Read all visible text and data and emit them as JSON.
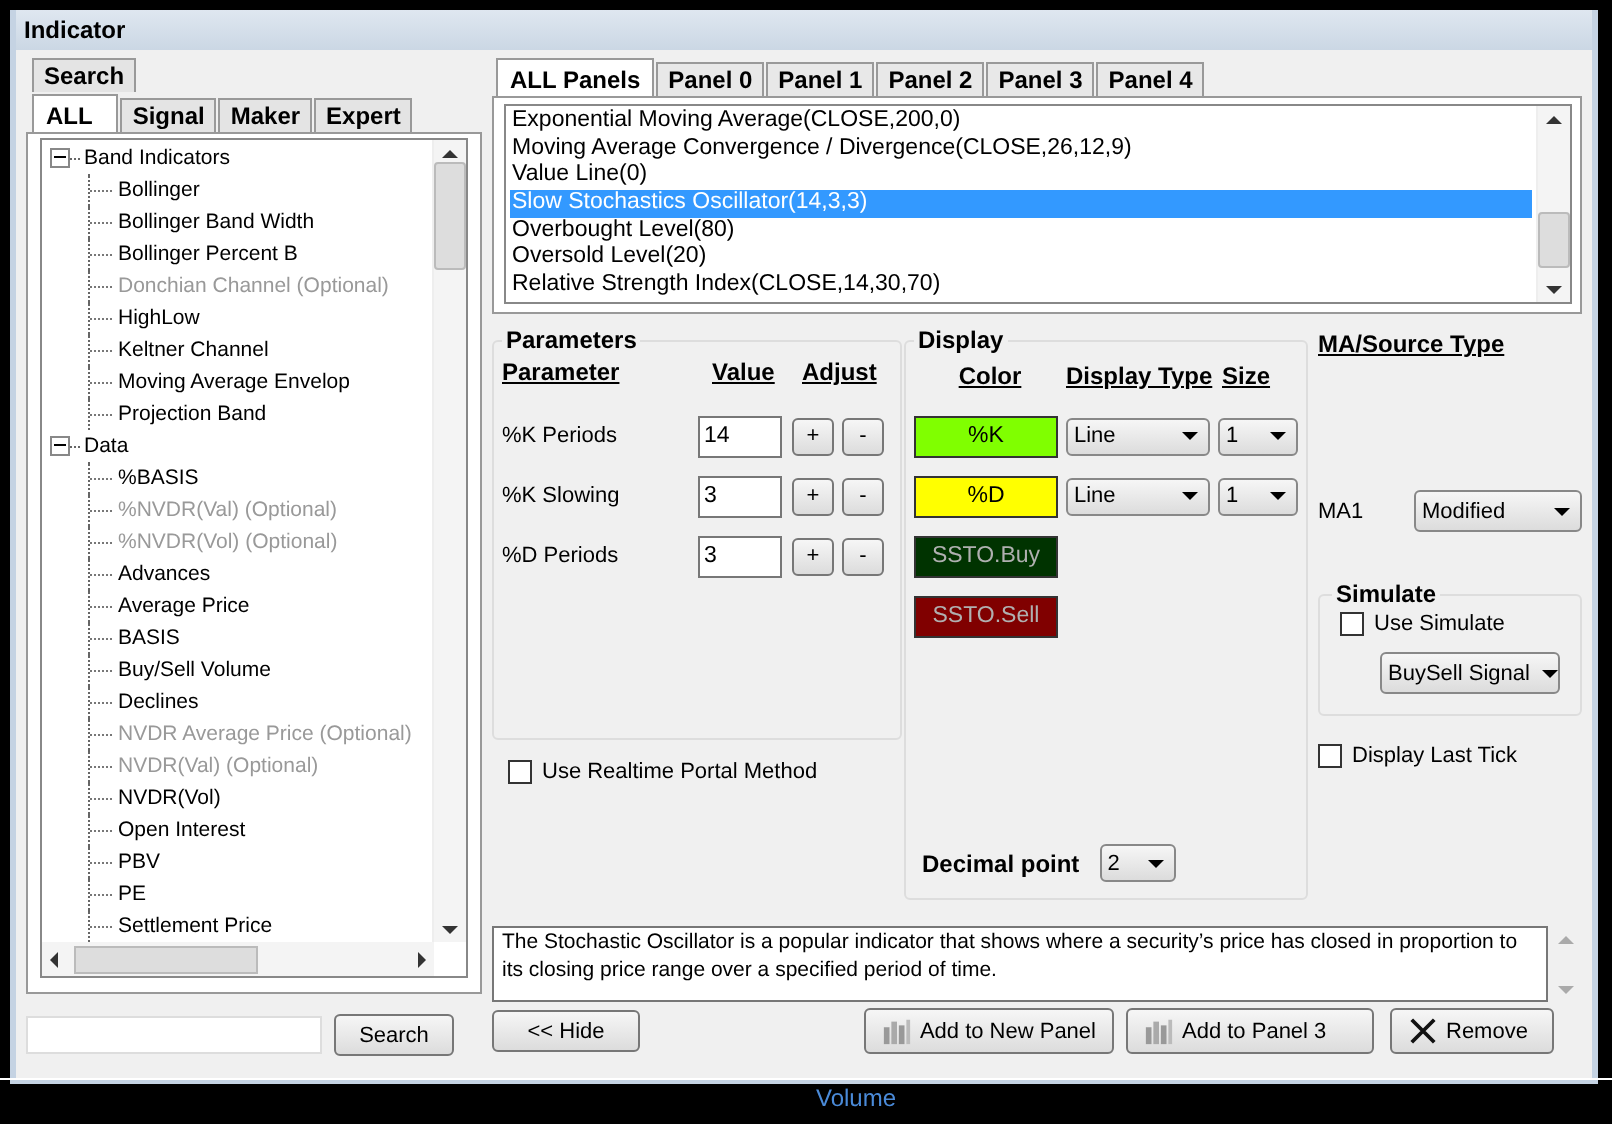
{
  "window": {
    "title": "Indicator"
  },
  "left_tab_rows": [
    [
      {
        "label": "Search",
        "selected": false
      }
    ],
    [
      {
        "label": "ALL",
        "selected": true
      },
      {
        "label": "Signal",
        "selected": false
      },
      {
        "label": "Maker",
        "selected": false
      },
      {
        "label": "Expert",
        "selected": false
      }
    ]
  ],
  "tree": [
    {
      "label": "Band Indicators",
      "expanded": true,
      "children": [
        {
          "label": "Bollinger",
          "disabled": false
        },
        {
          "label": "Bollinger Band Width",
          "disabled": false
        },
        {
          "label": "Bollinger Percent B",
          "disabled": false
        },
        {
          "label": "Donchian Channel (Optional)",
          "disabled": true
        },
        {
          "label": "HighLow",
          "disabled": false
        },
        {
          "label": "Keltner Channel",
          "disabled": false
        },
        {
          "label": "Moving Average Envelop",
          "disabled": false
        },
        {
          "label": "Projection Band",
          "disabled": false
        }
      ]
    },
    {
      "label": "Data",
      "expanded": true,
      "children": [
        {
          "label": "%BASIS",
          "disabled": false
        },
        {
          "label": "%NVDR(Val) (Optional)",
          "disabled": true
        },
        {
          "label": "%NVDR(Vol) (Optional)",
          "disabled": true
        },
        {
          "label": "Advances",
          "disabled": false
        },
        {
          "label": "Average Price",
          "disabled": false
        },
        {
          "label": "BASIS",
          "disabled": false
        },
        {
          "label": "Buy/Sell Volume",
          "disabled": false
        },
        {
          "label": "Declines",
          "disabled": false
        },
        {
          "label": "NVDR Average Price (Optional)",
          "disabled": true
        },
        {
          "label": "NVDR(Val) (Optional)",
          "disabled": true
        },
        {
          "label": "NVDR(Vol)",
          "disabled": false
        },
        {
          "label": "Open Interest",
          "disabled": false
        },
        {
          "label": "PBV",
          "disabled": false
        },
        {
          "label": "PE",
          "disabled": false
        },
        {
          "label": "Settlement Price",
          "disabled": false
        }
      ]
    }
  ],
  "search": {
    "button": "Search"
  },
  "panel_tabs": [
    {
      "label": "ALL Panels",
      "selected": true
    },
    {
      "label": "Panel 0",
      "selected": false
    },
    {
      "label": "Panel 1",
      "selected": false
    },
    {
      "label": "Panel 2",
      "selected": false
    },
    {
      "label": "Panel 3",
      "selected": false
    },
    {
      "label": "Panel 4",
      "selected": false
    }
  ],
  "indicators": [
    {
      "label": "Exponential Moving Average(CLOSE,200,0)",
      "selected": false
    },
    {
      "label": "Moving Average Convergence / Divergence(CLOSE,26,12,9)",
      "selected": false
    },
    {
      "label": "Value Line(0)",
      "selected": false
    },
    {
      "label": "Slow Stochastics Oscillator(14,3,3)",
      "selected": true
    },
    {
      "label": "Overbought Level(80)",
      "selected": false
    },
    {
      "label": "Oversold Level(20)",
      "selected": false
    },
    {
      "label": "Relative Strength Index(CLOSE,14,30,70)",
      "selected": false
    }
  ],
  "parameters": {
    "title": "Parameters",
    "headers": [
      "Parameter",
      "Value",
      "Adjust"
    ],
    "rows": [
      {
        "name": "%K Periods",
        "value": "14",
        "plus": "+",
        "minus": "-"
      },
      {
        "name": "%K Slowing",
        "value": "3",
        "plus": "+",
        "minus": "-"
      },
      {
        "name": "%D Periods",
        "value": "3",
        "plus": "+",
        "minus": "-"
      }
    ]
  },
  "realtime": {
    "label": "Use Realtime Portal Method",
    "checked": false
  },
  "display": {
    "title": "Display",
    "headers": [
      "Color",
      "Display Type",
      "Size"
    ],
    "rows": [
      {
        "kind": "line",
        "label": "%K",
        "color": "#80ff00",
        "type": "Line",
        "size": "1"
      },
      {
        "kind": "line",
        "label": "%D",
        "color": "#ffff00",
        "type": "Line",
        "size": "1"
      },
      {
        "kind": "signal",
        "label": "SSTO.Buy",
        "color": "#003300"
      },
      {
        "kind": "signal",
        "label": "SSTO.Sell",
        "color": "#800000"
      }
    ]
  },
  "decimal": {
    "label": "Decimal point",
    "value": "2"
  },
  "ma_source": {
    "title": "MA/Source Type",
    "label": "MA1",
    "value": "Modified"
  },
  "simulate": {
    "title": "Simulate",
    "checkbox": {
      "label": "Use Simulate",
      "checked": false
    },
    "select": "BuySell Signal"
  },
  "display_last_tick": {
    "label": "Display Last Tick",
    "checked": false
  },
  "description": "The Stochastic Oscillator is a popular indicator that shows where a security’s price has closed in proportion to its closing price range over a specified period of time.",
  "hide_button": "<< Hide",
  "buttons": [
    {
      "kind": "chart",
      "label": "Add to New Panel"
    },
    {
      "kind": "chart",
      "label": "Add to Panel 3"
    },
    {
      "kind": "close",
      "label": "Remove"
    }
  ],
  "chart_label": "Volume"
}
